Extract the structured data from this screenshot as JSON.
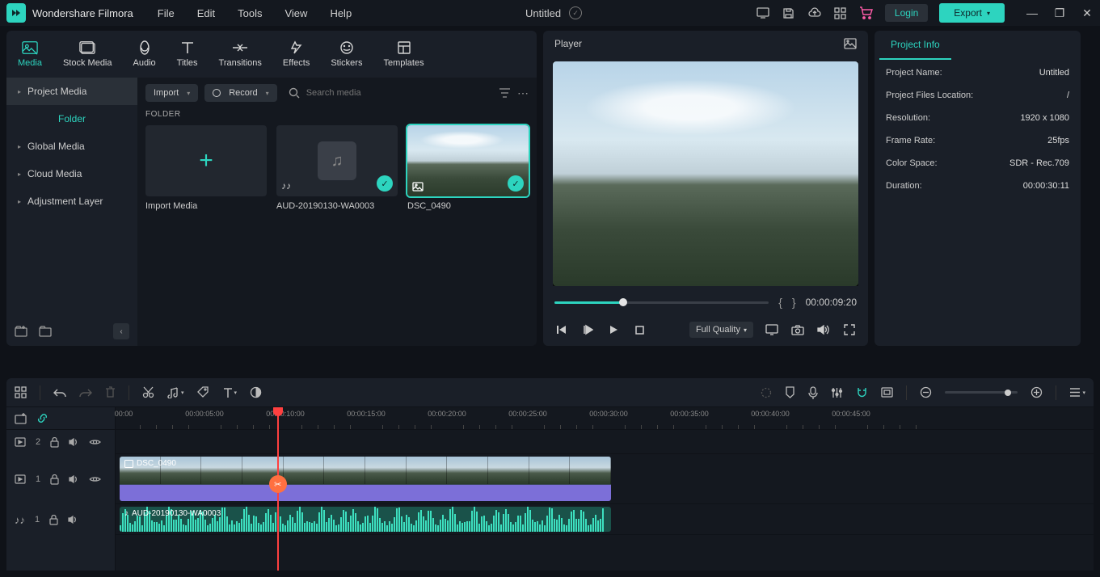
{
  "app": {
    "name": "Wondershare Filmora"
  },
  "menu": [
    "File",
    "Edit",
    "Tools",
    "View",
    "Help"
  ],
  "document": {
    "title": "Untitled"
  },
  "titlebar": {
    "login": "Login",
    "export": "Export"
  },
  "tabs": [
    "Media",
    "Stock Media",
    "Audio",
    "Titles",
    "Transitions",
    "Effects",
    "Stickers",
    "Templates"
  ],
  "sidebar": {
    "project_media": "Project Media",
    "folder": "Folder",
    "items": [
      "Global Media",
      "Cloud Media",
      "Adjustment Layer"
    ]
  },
  "mediaToolbar": {
    "import": "Import",
    "record": "Record",
    "search_placeholder": "Search media"
  },
  "folderLabel": "FOLDER",
  "thumbs": {
    "import": "Import Media",
    "audio": "AUD-20190130-WA0003",
    "image": "DSC_0490"
  },
  "player": {
    "title": "Player",
    "timecode": "00:00:09:20",
    "quality": "Full Quality"
  },
  "info": {
    "tab": "Project Info",
    "rows": [
      {
        "k": "Project Name:",
        "v": "Untitled"
      },
      {
        "k": "Project Files Location:",
        "v": "/"
      },
      {
        "k": "Resolution:",
        "v": "1920 x 1080"
      },
      {
        "k": "Frame Rate:",
        "v": "25fps"
      },
      {
        "k": "Color Space:",
        "v": "SDR - Rec.709"
      },
      {
        "k": "Duration:",
        "v": "00:00:30:11"
      }
    ]
  },
  "timeline": {
    "ruler": [
      "00:00",
      "00:00:05:00",
      "00:00:10:00",
      "00:00:15:00",
      "00:00:20:00",
      "00:00:25:00",
      "00:00:30:00",
      "00:00:35:00",
      "00:00:40:00",
      "00:00:45:00"
    ],
    "tracks": {
      "v2": "2",
      "v1": "1",
      "a1": "1"
    },
    "clips": {
      "video": "DSC_0490",
      "audio": "AUD-20190130-WA0003"
    }
  }
}
